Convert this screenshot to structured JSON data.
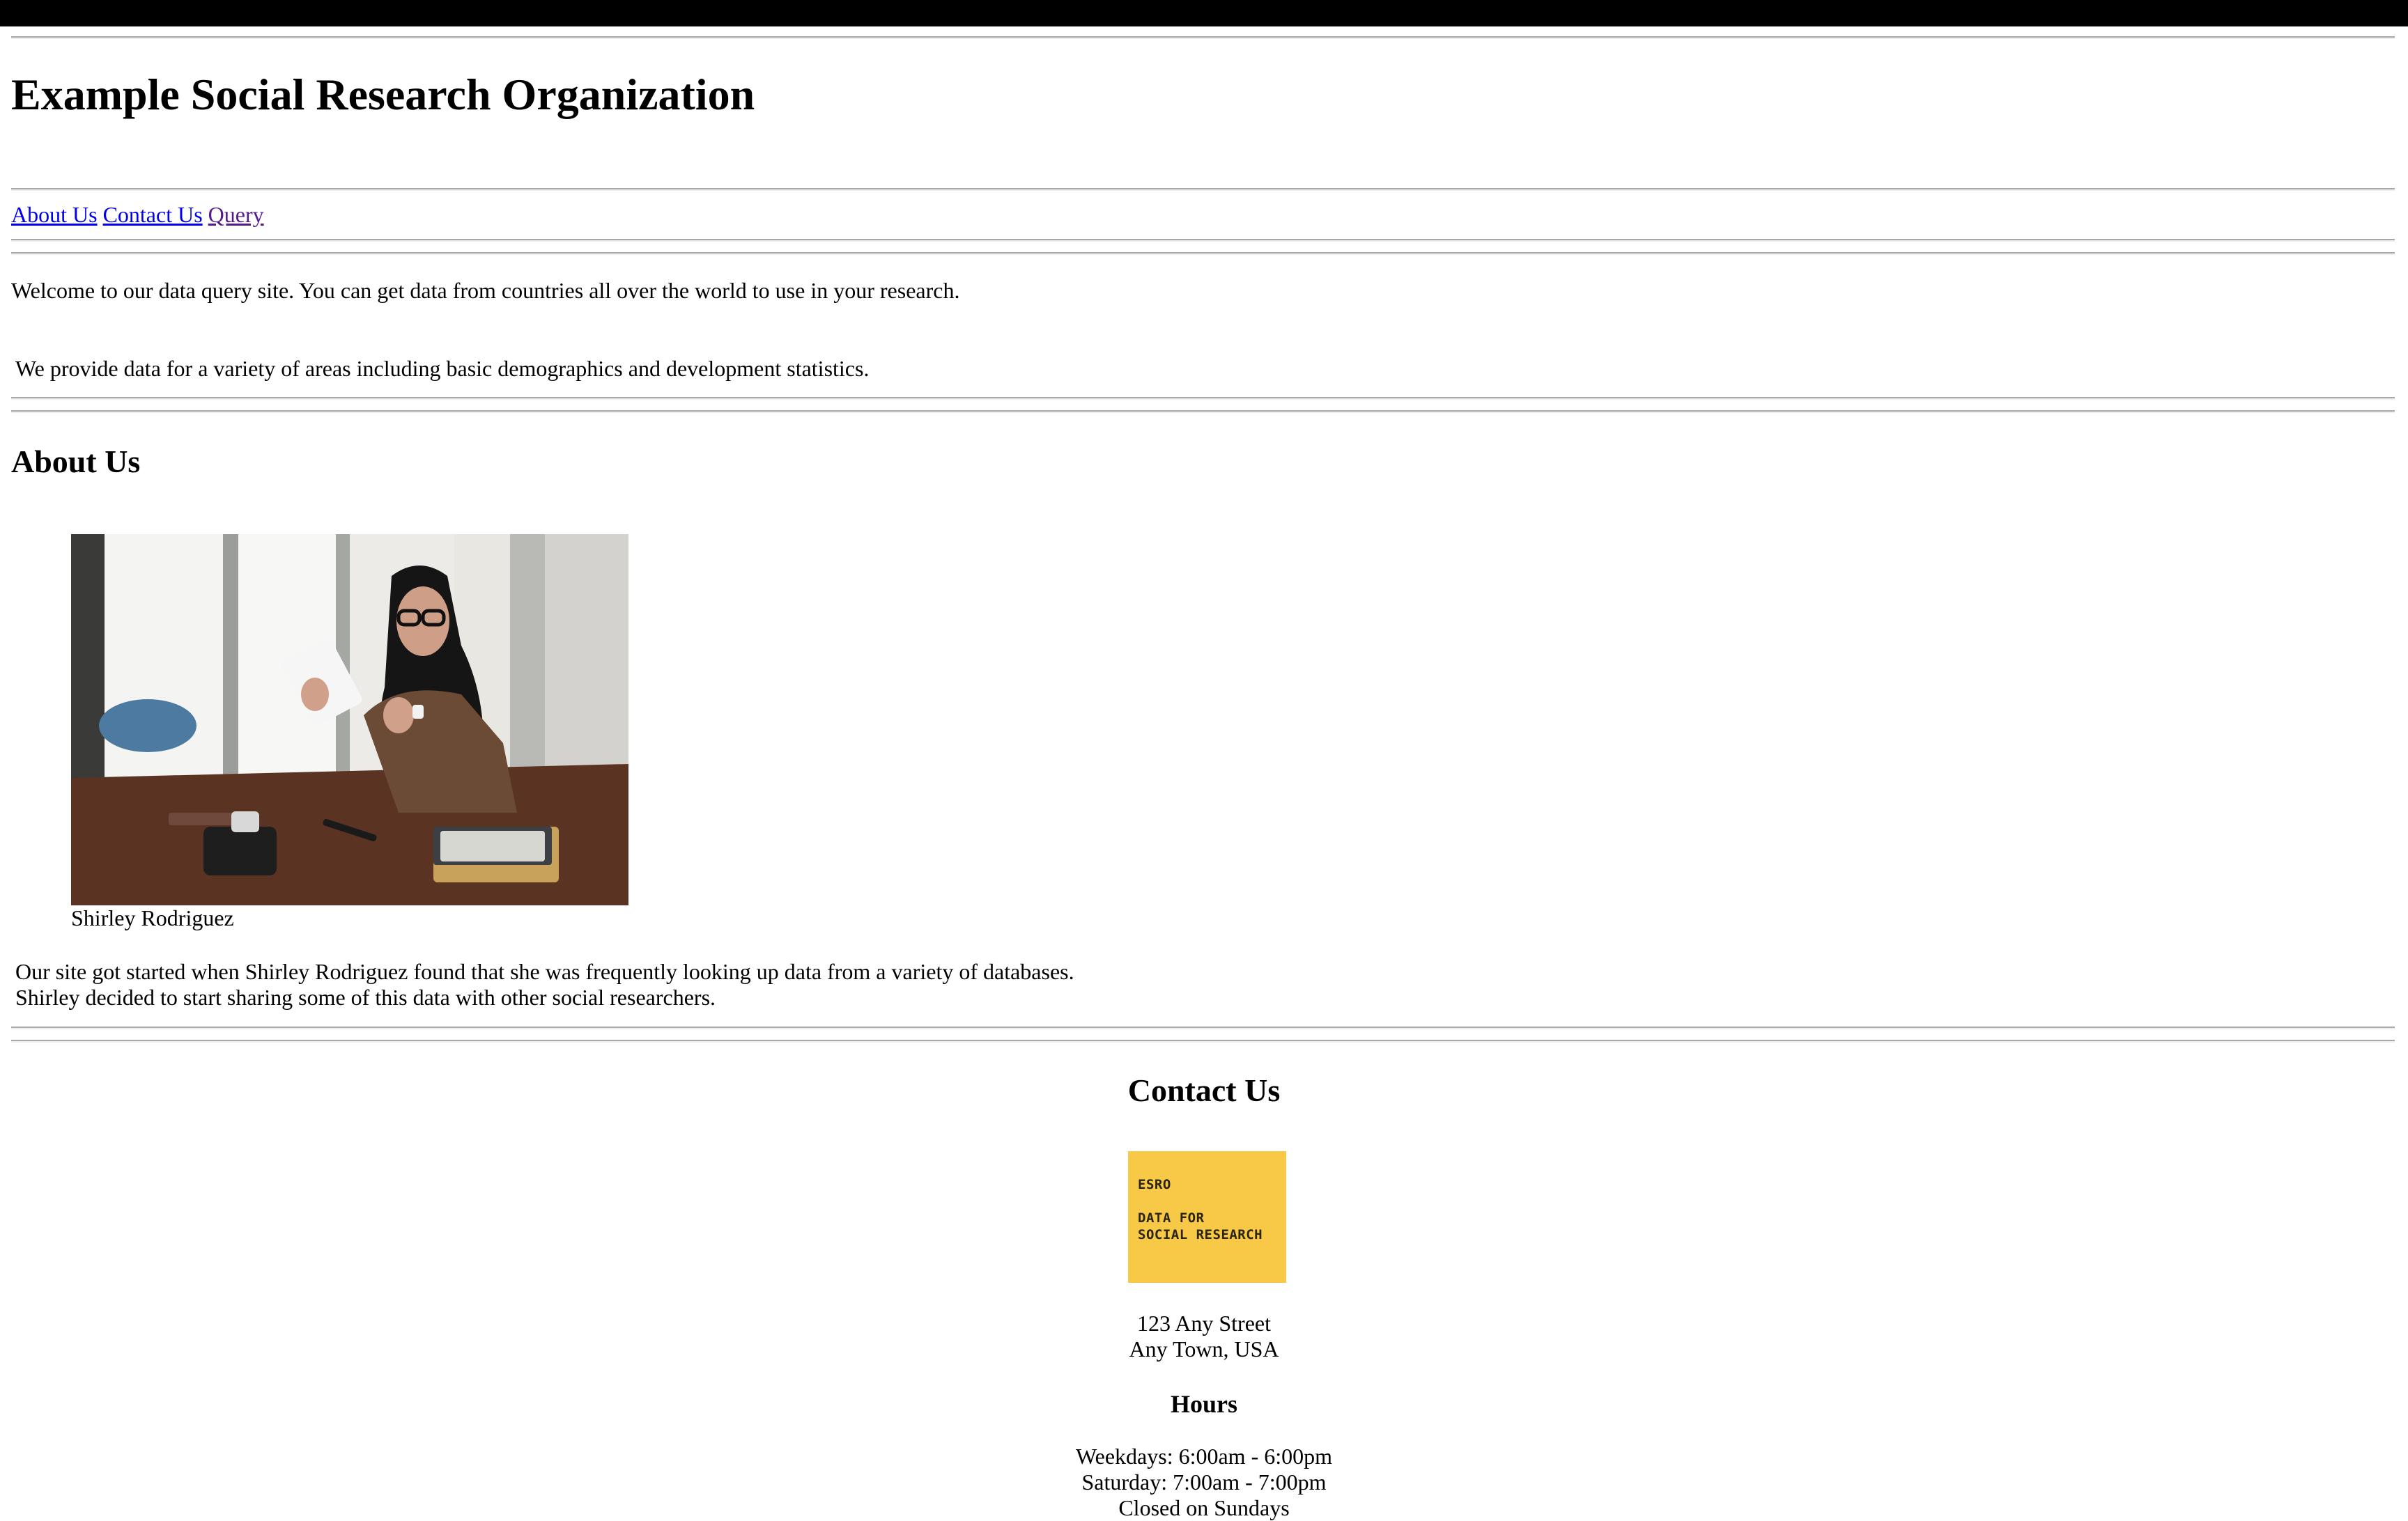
{
  "site": {
    "title": "Example Social Research Organization"
  },
  "nav": {
    "items": [
      {
        "label": "About Us"
      },
      {
        "label": "Contact Us"
      },
      {
        "label": "Query"
      }
    ]
  },
  "intro": {
    "welcome": "Welcome to our data query site. You can get data from countries all over the world to use in your research.",
    "provide": "We provide data for a variety of areas including basic demographics and development statistics."
  },
  "about": {
    "heading": "About Us",
    "photo_caption": "Shirley Rodriguez",
    "paragraph_line1": "Our site got started when Shirley Rodriguez found that she was frequently looking up data from a variety of databases.",
    "paragraph_line2": "Shirley decided to start sharing some of this data with other social researchers."
  },
  "contact": {
    "heading": "Contact Us",
    "logo": {
      "line1": "ESRO",
      "line2": "DATA FOR",
      "line3": "SOCIAL RESEARCH"
    },
    "address_line1": "123 Any Street",
    "address_line2": "Any Town, USA",
    "hours_heading": "Hours",
    "hours": [
      "Weekdays: 6:00am - 6:00pm",
      "Saturday: 7:00am - 7:00pm",
      "Closed on Sundays"
    ]
  },
  "colors": {
    "link": "#0000ee",
    "link_visited": "#551a8b",
    "logo_bg": "#f7c946"
  }
}
